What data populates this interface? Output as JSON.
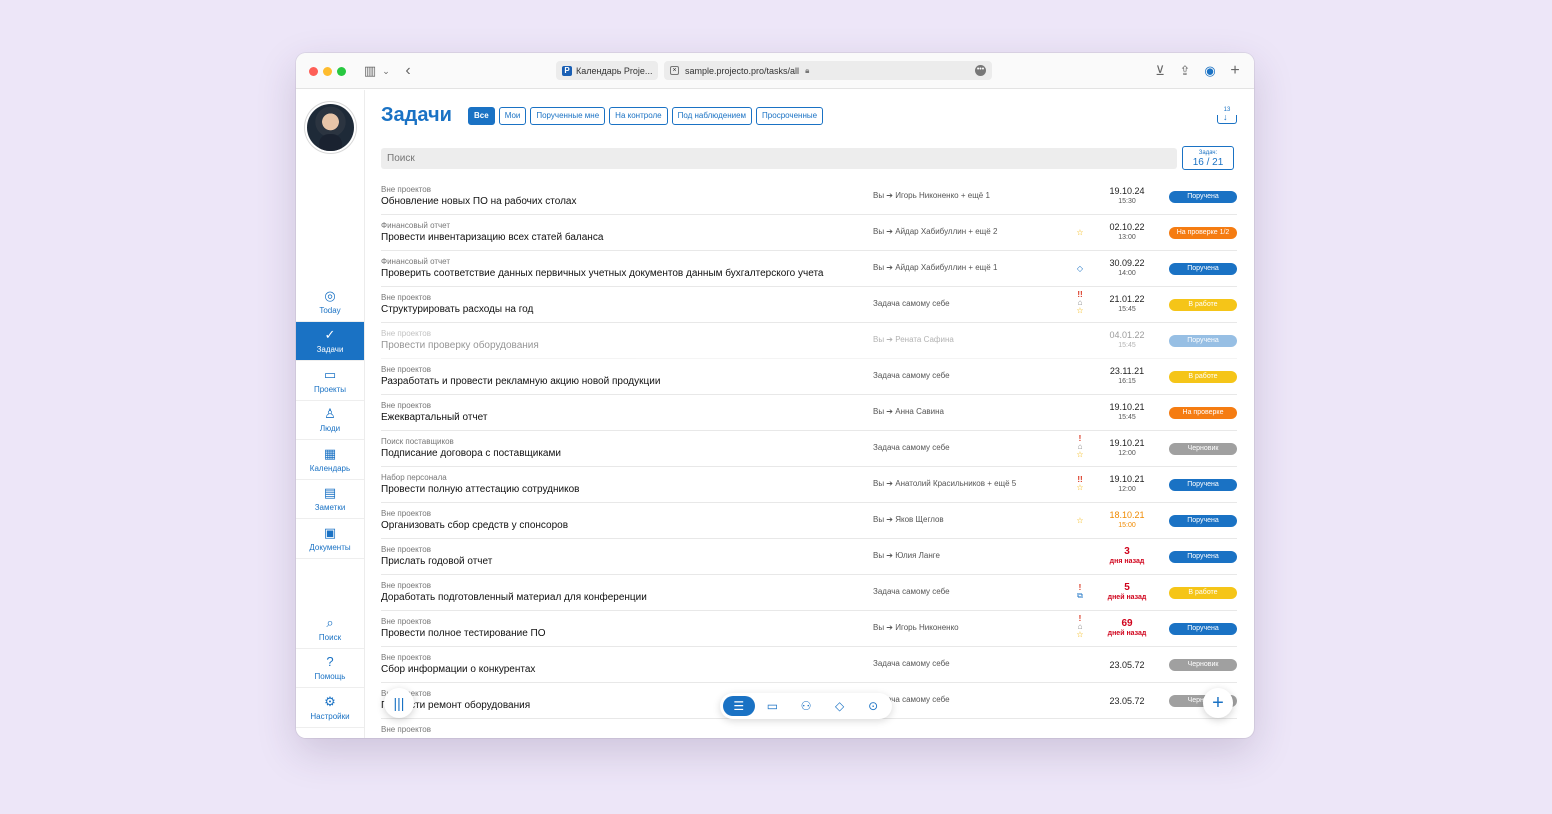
{
  "browser": {
    "tab_title": "Календарь Proje...",
    "tab_favicon": "P",
    "url": "sample.projecto.pro/tasks/all"
  },
  "sidebar": {
    "items": [
      {
        "label": "Today",
        "icon": "compass-icon",
        "glyph": "◎"
      },
      {
        "label": "Задачи",
        "icon": "check-circle-icon",
        "glyph": "✓"
      },
      {
        "label": "Проекты",
        "icon": "briefcase-icon",
        "glyph": "▭"
      },
      {
        "label": "Люди",
        "icon": "person-icon",
        "glyph": "♙"
      },
      {
        "label": "Календарь",
        "icon": "calendar-icon",
        "glyph": "▦"
      },
      {
        "label": "Заметки",
        "icon": "document-icon",
        "glyph": "▤"
      },
      {
        "label": "Документы",
        "icon": "archive-icon",
        "glyph": "▣"
      }
    ],
    "bottom_items": [
      {
        "label": "Поиск",
        "icon": "search-icon",
        "glyph": "⌕"
      },
      {
        "label": "Помощь",
        "icon": "help-icon",
        "glyph": "?"
      },
      {
        "label": "Настройки",
        "icon": "gear-icon",
        "glyph": "⚙"
      }
    ]
  },
  "header": {
    "title": "Задачи",
    "filters": [
      "Все",
      "Мои",
      "Порученные мне",
      "На контроле",
      "Под наблюдением",
      "Просроченные"
    ],
    "inbox_count": "13"
  },
  "search": {
    "placeholder": "Поиск"
  },
  "counter": {
    "label": "Задач:",
    "value": "16 / 21"
  },
  "colors": {
    "accent": "#1a72c4",
    "status_blue": "#1a72c4",
    "status_yellow": "#f5c518",
    "status_orange": "#f57c12",
    "status_gray": "#a0a0a0",
    "overdue_red": "#d0021b"
  },
  "tasks": [
    {
      "project": "Вне проектов",
      "name": "Обновление новых ПО на рабочих столах",
      "assign": "Вы ➔ Игорь Никоненко + ещё 1",
      "icons": "",
      "date": "19.10.24",
      "time": "15:30",
      "date_style": "",
      "status": "Поручена",
      "status_color": "blue"
    },
    {
      "project": "Финансовый отчет",
      "name": "Провести инвентаризацию всех статей баланса",
      "assign": "Вы ➔ Айдар Хабибуллин + ещё 2",
      "icons": "star",
      "date": "02.10.22",
      "time": "13:00",
      "date_style": "",
      "status": "На проверке 1/2",
      "status_color": "orange"
    },
    {
      "project": "Финансовый отчет",
      "name": "Проверить соответствие данных первичных учетных документов данным бухгалтерского учета",
      "assign": "Вы ➔ Айдар Хабибуллин + ещё 1",
      "icons": "tag",
      "date": "30.09.22",
      "time": "14:00",
      "date_style": "",
      "status": "Поручена",
      "status_color": "blue"
    },
    {
      "project": "Вне проектов",
      "name": "Структурировать расходы на год",
      "assign": "Задача самому себе",
      "icons": "ex2-lock-star",
      "date": "21.01.22",
      "time": "15:45",
      "date_style": "",
      "status": "В работе",
      "status_color": "yellow"
    },
    {
      "project": "Вне проектов",
      "name": "Провести проверку оборудования",
      "assign": "Вы ➔ Рената Сафина",
      "icons": "",
      "date": "04.01.22",
      "time": "15:45",
      "date_style": "",
      "status": "Поручена",
      "status_color": "blue",
      "dim": true
    },
    {
      "project": "Вне проектов",
      "name": "Разработать и провести рекламную акцию новой продукции",
      "assign": "Задача самому себе",
      "icons": "",
      "date": "23.11.21",
      "time": "16:15",
      "date_style": "",
      "status": "В работе",
      "status_color": "yellow"
    },
    {
      "project": "Вне проектов",
      "name": "Ежеквартальный отчет",
      "assign": "Вы ➔ Анна Савина",
      "icons": "",
      "date": "19.10.21",
      "time": "15:45",
      "date_style": "",
      "status": "На проверке",
      "status_color": "orange"
    },
    {
      "project": "Поиск поставщиков",
      "name": "Подписание договора с поставщиками",
      "assign": "Задача самому себе",
      "icons": "ex1-lock-star",
      "date": "19.10.21",
      "time": "12:00",
      "date_style": "",
      "status": "Черновик",
      "status_color": "gray"
    },
    {
      "project": "Набор персонала",
      "name": "Провести полную аттестацию сотрудников",
      "assign": "Вы ➔ Анатолий Красильников + ещё 5",
      "icons": "ex2-star",
      "date": "19.10.21",
      "time": "12:00",
      "date_style": "",
      "status": "Поручена",
      "status_color": "blue"
    },
    {
      "project": "Вне проектов",
      "name": "Организовать сбор средств у спонсоров",
      "assign": "Вы ➔ Яков Щеглов",
      "icons": "star",
      "date": "18.10.21",
      "time": "15:00",
      "date_style": "orange",
      "status": "Поручена",
      "status_color": "blue"
    },
    {
      "project": "Вне проектов",
      "name": "Прислать годовой отчет",
      "assign": "Вы ➔ Юлия Ланге",
      "icons": "",
      "date": "3",
      "time": "дня назад",
      "date_style": "red",
      "status": "Поручена",
      "status_color": "blue"
    },
    {
      "project": "Вне проектов",
      "name": "Доработать подготовленный материал для конференции",
      "assign": "Задача самому себе",
      "icons": "ex1-copy",
      "date": "5",
      "time": "дней назад",
      "date_style": "red",
      "status": "В работе",
      "status_color": "yellow"
    },
    {
      "project": "Вне проектов",
      "name": "Провести полное тестирование ПО",
      "assign": "Вы ➔ Игорь Никоненко",
      "icons": "ex1-lock-star",
      "date": "69",
      "time": "дней назад",
      "date_style": "red",
      "status": "Поручена",
      "status_color": "blue"
    },
    {
      "project": "Вне проектов",
      "name": "Сбор информации о конкурентах",
      "assign": "Задача самому себе",
      "icons": "",
      "date": "23.05.72",
      "time": "",
      "date_style": "plain",
      "status": "Черновик",
      "status_color": "gray"
    },
    {
      "project": "Вне проектов",
      "name": "Провести ремонт оборудования",
      "assign": "Задача самому себе",
      "icons": "",
      "date": "23.05.72",
      "time": "",
      "date_style": "plain",
      "status": "Черновик",
      "status_color": "gray"
    },
    {
      "project": "Вне проектов",
      "name": "",
      "assign": "",
      "icons": "",
      "date": "",
      "time": "",
      "date_style": "",
      "status": "",
      "status_color": ""
    }
  ],
  "bottom_nav": [
    {
      "icon": "list-icon",
      "glyph": "☰",
      "active": true
    },
    {
      "icon": "briefcase-icon",
      "glyph": "▭",
      "active": false
    },
    {
      "icon": "people-icon",
      "glyph": "⚇",
      "active": false
    },
    {
      "icon": "tag-icon",
      "glyph": "◇",
      "active": false
    },
    {
      "icon": "location-icon",
      "glyph": "⊙",
      "active": false
    }
  ]
}
